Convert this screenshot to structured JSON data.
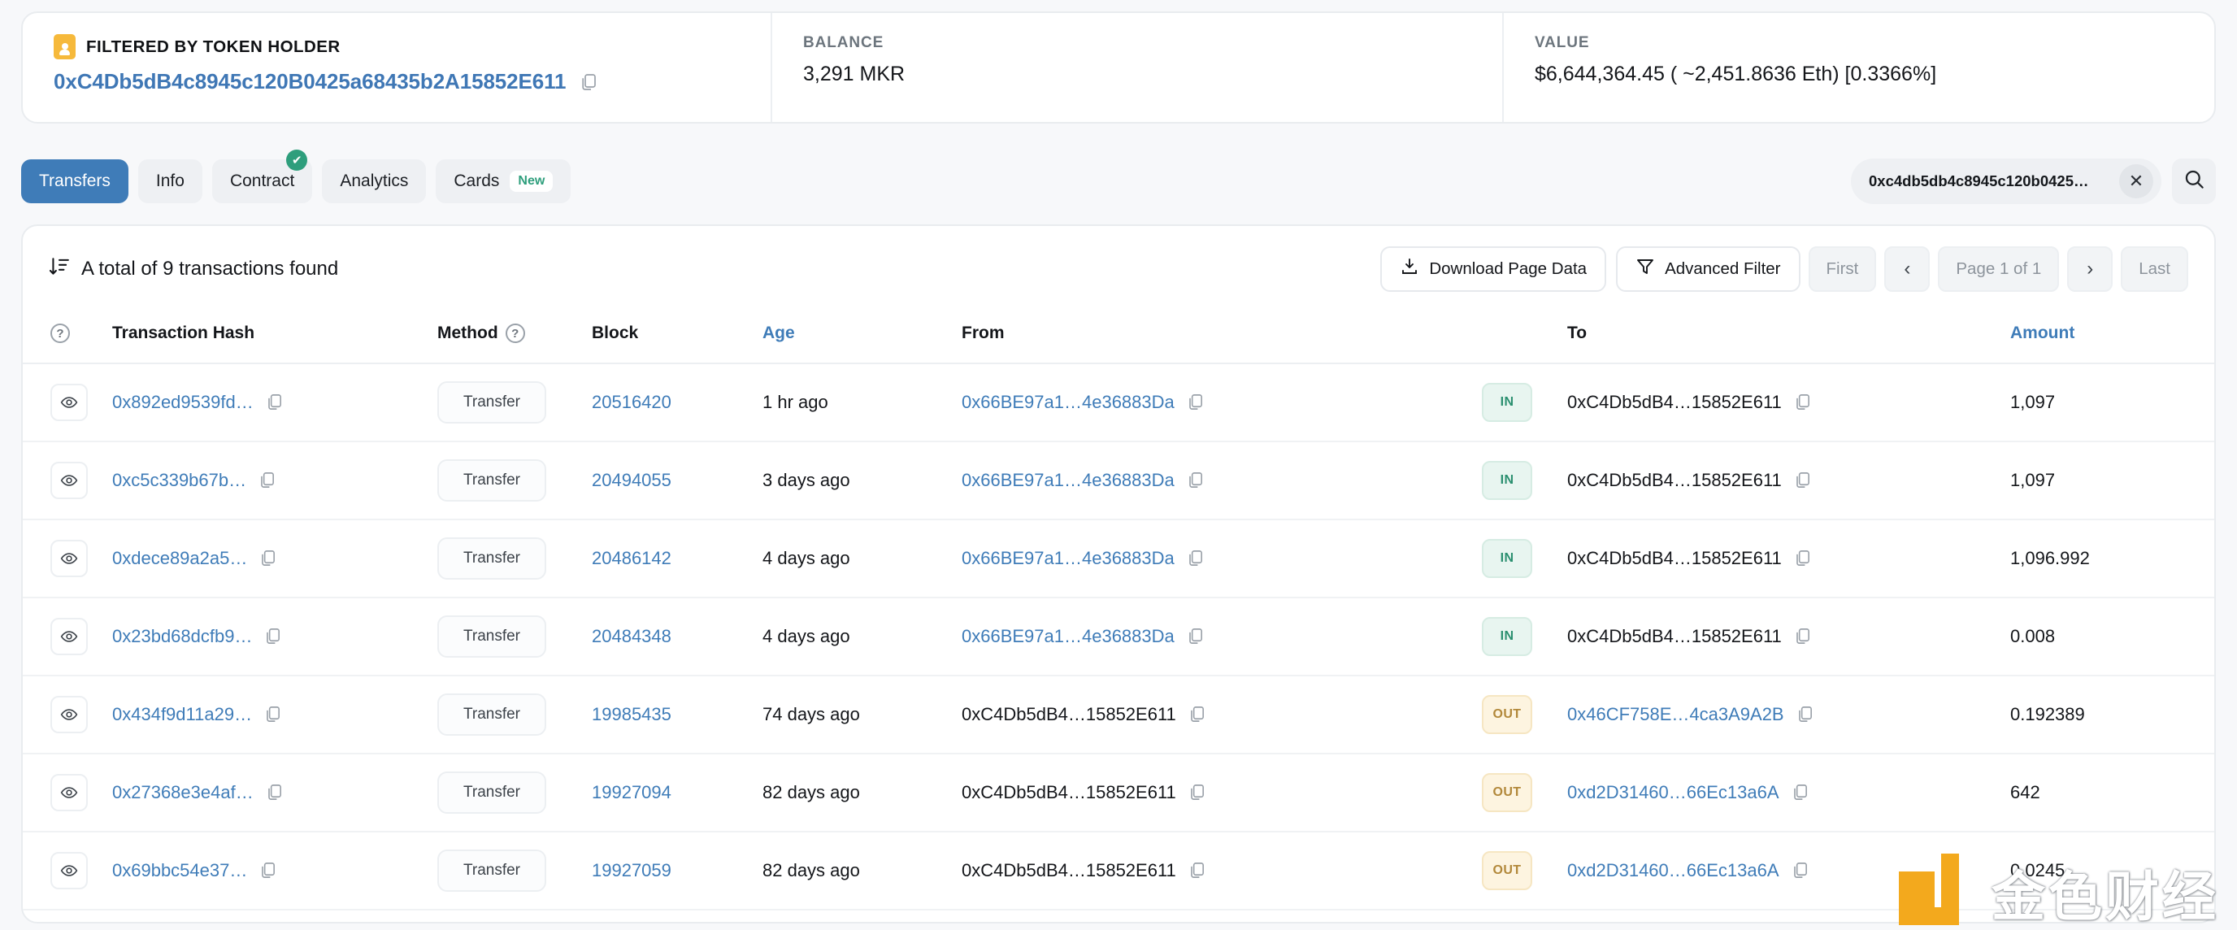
{
  "summary": {
    "filter_label": "FILTERED BY TOKEN HOLDER",
    "address": "0xC4Db5dB4c8945c120B0425a68435b2A15852E611",
    "balance_label": "BALANCE",
    "balance_value": "3,291 MKR",
    "value_label": "VALUE",
    "value_value": "$6,644,364.45 ( ~2,451.8636 Eth) [0.3366%]",
    "accent": "#f6b93b"
  },
  "tabs": [
    {
      "label": "Transfers",
      "active": true,
      "badge": "",
      "check": false
    },
    {
      "label": "Info",
      "active": false,
      "badge": "",
      "check": false
    },
    {
      "label": "Contract",
      "active": false,
      "badge": "",
      "check": true
    },
    {
      "label": "Analytics",
      "active": false,
      "badge": "",
      "check": false
    },
    {
      "label": "Cards",
      "active": false,
      "badge": "New",
      "check": false
    }
  ],
  "search": {
    "value": "0xc4db5db4c8945c120b0425…",
    "placeholder": "Search",
    "clear_label": "✕"
  },
  "toolbar": {
    "total_text": "A total of 9 transactions found",
    "download_label": "Download Page Data",
    "advanced_filter_label": "Advanced Filter",
    "first_label": "First",
    "prev_label": "‹",
    "page_label": "Page 1 of 1",
    "next_label": "›",
    "last_label": "Last"
  },
  "table": {
    "headers": {
      "eye": "",
      "hash": "Transaction Hash",
      "method": "Method",
      "block": "Block",
      "age": "Age",
      "from": "From",
      "io": "",
      "to": "To",
      "amount": "Amount"
    },
    "rows": [
      {
        "hash": "0x892ed9539fd…",
        "method": "Transfer",
        "block": "20516420",
        "age": "1 hr ago",
        "from": "0x66BE97a1…4e36883Da",
        "from_link": true,
        "direction": "IN",
        "to": "0xC4Db5dB4…15852E611",
        "to_link": false,
        "amount": "1,097"
      },
      {
        "hash": "0xc5c339b67b…",
        "method": "Transfer",
        "block": "20494055",
        "age": "3 days ago",
        "from": "0x66BE97a1…4e36883Da",
        "from_link": true,
        "direction": "IN",
        "to": "0xC4Db5dB4…15852E611",
        "to_link": false,
        "amount": "1,097"
      },
      {
        "hash": "0xdece89a2a5…",
        "method": "Transfer",
        "block": "20486142",
        "age": "4 days ago",
        "from": "0x66BE97a1…4e36883Da",
        "from_link": true,
        "direction": "IN",
        "to": "0xC4Db5dB4…15852E611",
        "to_link": false,
        "amount": "1,096.992"
      },
      {
        "hash": "0x23bd68dcfb9…",
        "method": "Transfer",
        "block": "20484348",
        "age": "4 days ago",
        "from": "0x66BE97a1…4e36883Da",
        "from_link": true,
        "direction": "IN",
        "to": "0xC4Db5dB4…15852E611",
        "to_link": false,
        "amount": "0.008"
      },
      {
        "hash": "0x434f9d11a29…",
        "method": "Transfer",
        "block": "19985435",
        "age": "74 days ago",
        "from": "0xC4Db5dB4…15852E611",
        "from_link": false,
        "direction": "OUT",
        "to": "0x46CF758E…4ca3A9A2B",
        "to_link": true,
        "amount": "0.192389"
      },
      {
        "hash": "0x27368e3e4af…",
        "method": "Transfer",
        "block": "19927094",
        "age": "82 days ago",
        "from": "0xC4Db5dB4…15852E611",
        "from_link": false,
        "direction": "OUT",
        "to": "0xd2D31460…66Ec13a6A",
        "to_link": true,
        "amount": "642"
      },
      {
        "hash": "0x69bbc54e37…",
        "method": "Transfer",
        "block": "19927059",
        "age": "82 days ago",
        "from": "0xC4Db5dB4…15852E611",
        "from_link": false,
        "direction": "OUT",
        "to": "0xd2D31460…66Ec13a6A",
        "to_link": true,
        "amount": "0.0245"
      }
    ]
  },
  "watermark": {
    "text": "金色财经",
    "color": "#f3a91d"
  }
}
